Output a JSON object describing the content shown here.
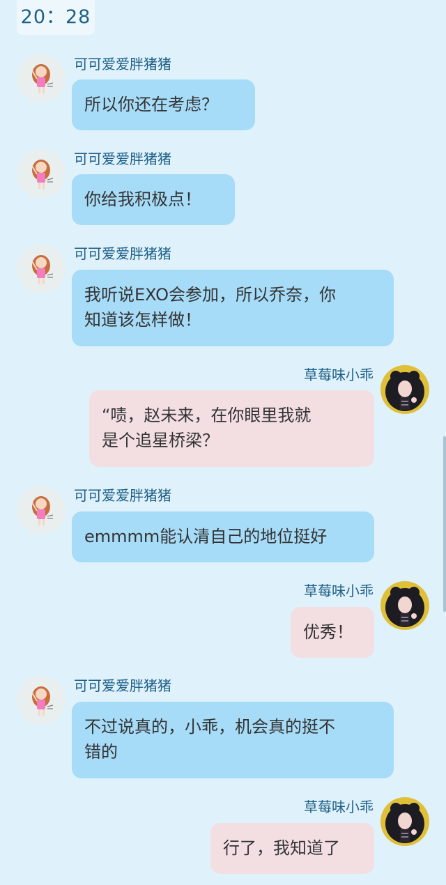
{
  "status": {
    "time": "20：28"
  },
  "colors": {
    "background": "#dff1fb",
    "incoming_bubble": "#a7dcf8",
    "outgoing_bubble": "#f3dfe2",
    "name_text": "#1d5f86"
  },
  "users": {
    "other": {
      "name": "可可爱爱胖猪猪",
      "avatar_icon": "cartoon-girl-avatar-icon"
    },
    "self": {
      "name": "草莓味小乖",
      "avatar_icon": "dark-hair-girl-avatar-icon"
    }
  },
  "messages": [
    {
      "sender": "other",
      "name": "可可爱爱胖猪猪",
      "text": "所以你还在考虑？"
    },
    {
      "sender": "other",
      "name": "可可爱爱胖猪猪",
      "text": "你给我积极点！"
    },
    {
      "sender": "other",
      "name": "可可爱爱胖猪猪",
      "text": "我听说EXO会参加，所以乔奈，你\n知道该怎样做！"
    },
    {
      "sender": "self",
      "name": "草莓味小乖",
      "text": "“啧，赵未来，在你眼里我就\n是个追星桥梁？"
    },
    {
      "sender": "other",
      "name": "可可爱爱胖猪猪",
      "text": "emmmm能认清自己的地位挺好"
    },
    {
      "sender": "self",
      "name": "草莓味小乖",
      "text": "优秀！"
    },
    {
      "sender": "other",
      "name": "可可爱爱胖猪猪",
      "text": "不过说真的，小乖，机会真的挺不\n错的"
    },
    {
      "sender": "self",
      "name": "草莓味小乖",
      "text": "行了，我知道了"
    }
  ]
}
